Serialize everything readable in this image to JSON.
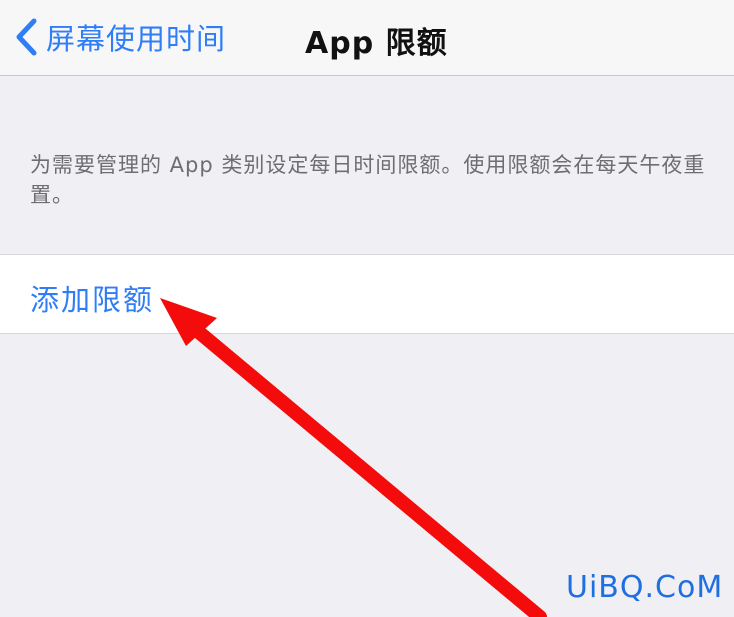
{
  "navbar": {
    "back_label": "屏幕使用时间",
    "title": "App 限额"
  },
  "main": {
    "description": "为需要管理的 App 类别设定每日时间限额。使用限额会在每天午夜重置。",
    "add_limit_label": "添加限额"
  },
  "watermark": {
    "text": "UiBQ.CoM"
  },
  "icons": {
    "back": "chevron-left-icon"
  },
  "colors": {
    "accent": "#2f7ef6",
    "annotation_arrow": "#f40c0c",
    "background": "#efeff4"
  }
}
